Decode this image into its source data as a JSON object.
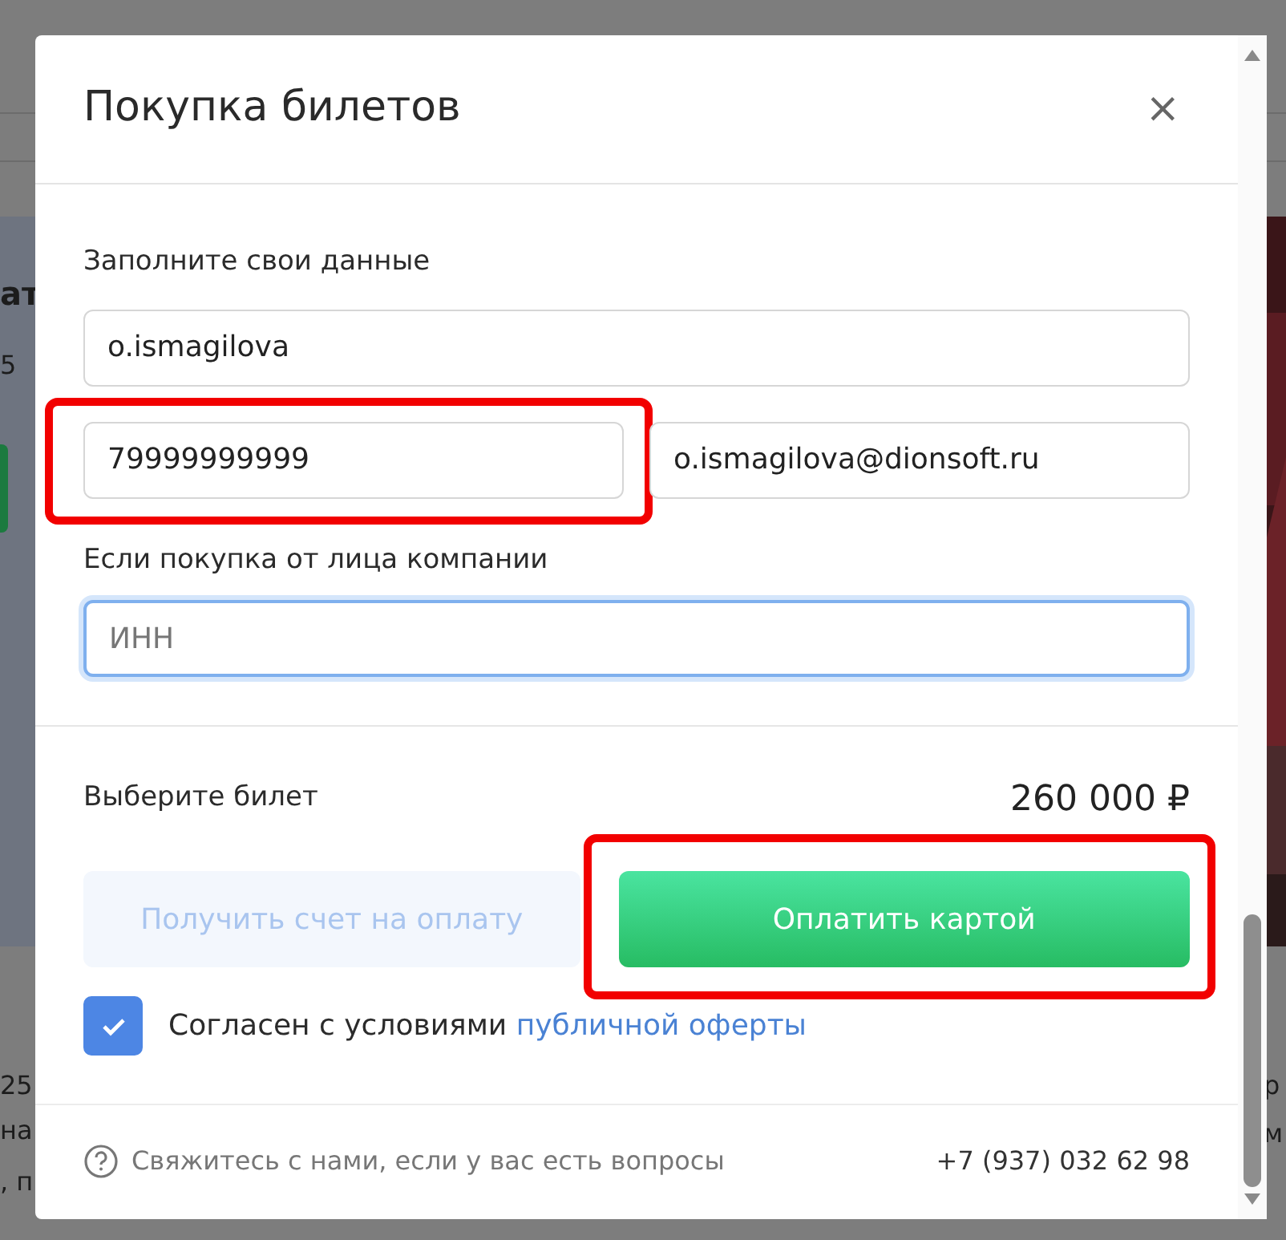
{
  "background": {
    "fragments": [
      {
        "text": "ат",
        "kind": "bold"
      },
      {
        "text": "5",
        "kind": "plain"
      },
      {
        "text": "25",
        "kind": "plain"
      },
      {
        "text": "на",
        "kind": "plain"
      },
      {
        "text": ", п",
        "kind": "plain"
      },
      {
        "text": "р",
        "kind": "right"
      },
      {
        "text": "м",
        "kind": "right"
      }
    ]
  },
  "modal": {
    "title": "Покупка билетов",
    "close": "×",
    "section_label": "Заполните свои данные",
    "fields": [
      {
        "value": "o.ismagilova",
        "focused": false,
        "highlighted": false
      },
      {
        "value": "79999999999",
        "focused": false,
        "highlighted": true
      },
      {
        "value": "o.ismagilova@dionsoft.ru",
        "focused": false,
        "highlighted": false
      }
    ],
    "company_label": "Если покупка от лица компании",
    "inn_field": {
      "placeholder": "ИНН",
      "focused": true
    },
    "ticket_label": "Выберите билет",
    "price": "260 000 ₽",
    "buttons": [
      {
        "label": "Получить счет на оплату",
        "kind": "invoice",
        "disabled": true,
        "highlighted": false
      },
      {
        "label": "Оплатить картой",
        "kind": "pay",
        "disabled": false,
        "highlighted": true
      }
    ],
    "agreement": {
      "checked": true,
      "text": "Согласен с условиями",
      "link": "публичной оферты"
    },
    "footer": {
      "help_text": "Свяжитесь с нами, если у вас есть вопросы",
      "phone": "+7 (937) 032 62 98"
    }
  }
}
